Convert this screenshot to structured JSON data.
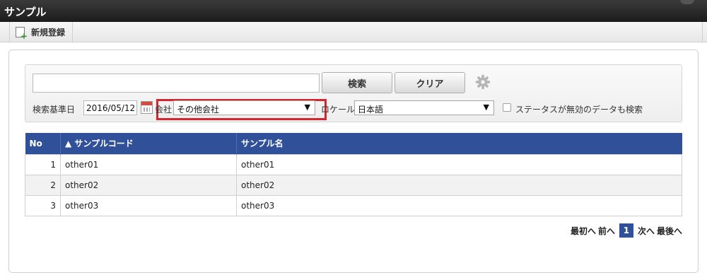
{
  "window": {
    "title": "サンプル"
  },
  "toolbar": {
    "new_label": "新規登録"
  },
  "search": {
    "keyword_value": "",
    "search_button": "検索",
    "clear_button": "クリア",
    "date_label": "検索基準日",
    "date_value": "2016/05/12",
    "company_label": "会社",
    "company_value": "その他会社",
    "locale_label": "ロケール",
    "locale_value": "日本語",
    "inactive_label": "ステータスが無効のデータも検索",
    "inactive_checked": false
  },
  "table": {
    "columns": [
      "No",
      "▲ サンプルコード",
      "サンプル名"
    ],
    "rows": [
      {
        "no": "1",
        "code": "other01",
        "name": "other01"
      },
      {
        "no": "2",
        "code": "other02",
        "name": "other02"
      },
      {
        "no": "3",
        "code": "other03",
        "name": "other03"
      }
    ]
  },
  "pager": {
    "first": "最初へ",
    "prev": "前へ",
    "current": "1",
    "next": "次へ",
    "last": "最後へ"
  },
  "colors": {
    "header_bg": "#30519a",
    "highlight": "#d4262c",
    "titlebar": "#2a2a2a"
  }
}
